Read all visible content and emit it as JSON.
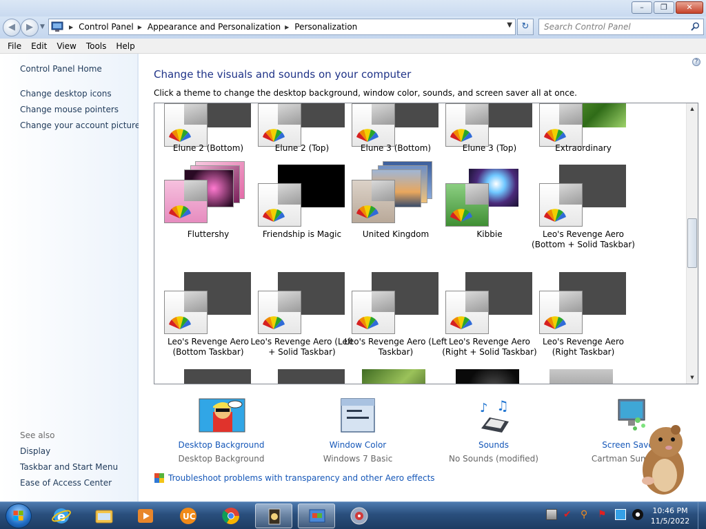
{
  "window": {
    "minimize_label": "–",
    "restore_label": "❐",
    "close_label": "✕"
  },
  "address": {
    "back": "◀",
    "forward": "▶",
    "crumbs": [
      "Control Panel",
      "Appearance and Personalization",
      "Personalization"
    ],
    "refresh": "↻",
    "search_placeholder": "Search Control Panel"
  },
  "menu": [
    "File",
    "Edit",
    "View",
    "Tools",
    "Help"
  ],
  "sidebar": {
    "links": [
      "Control Panel Home",
      "Change desktop icons",
      "Change mouse pointers",
      "Change your account picture"
    ],
    "see_also_label": "See also",
    "see_also": [
      "Display",
      "Taskbar and Start Menu",
      "Ease of Access Center"
    ]
  },
  "main": {
    "title": "Change the visuals and sounds on your computer",
    "description": "Click a theme to change the desktop background, window color, sounds, and screen saver all at once.",
    "themes_row1": [
      "Elune 2 (Bottom)",
      "Elune 2 (Top)",
      "Elune 3 (Bottom)",
      "Elune 3 (Top)",
      "Extraordinary"
    ],
    "themes_row2": [
      "Fluttershy",
      "Friendship is Magic",
      "United Kingdom",
      "Kibbie",
      "Leo's Revenge Aero (Bottom + Solid Taskbar)"
    ],
    "themes_row3": [
      "Leo's Revenge Aero (Bottom Taskbar)",
      "Leo's Revenge Aero (Left + Solid Taskbar)",
      "Leo's Revenge Aero (Left Taskbar)",
      "Leo's Revenge Aero (Right + Solid Taskbar)",
      "Leo's Revenge Aero (Right Taskbar)"
    ],
    "settings": [
      {
        "title": "Desktop Background",
        "subtitle": "Desktop Background"
      },
      {
        "title": "Window Color",
        "subtitle": "Windows 7 Basic"
      },
      {
        "title": "Sounds",
        "subtitle": "No Sounds (modified)"
      },
      {
        "title": "Screen Saver",
        "subtitle": "Cartman Sumo Wr"
      }
    ],
    "troubleshoot": "Troubleshoot problems with transparency and other Aero effects"
  },
  "taskbar": {
    "time": "10:46 PM",
    "date": "11/5/2022"
  },
  "colors": {
    "link": "#1557b8",
    "title": "#1e3287",
    "taskbar": "#2a4f7d"
  }
}
